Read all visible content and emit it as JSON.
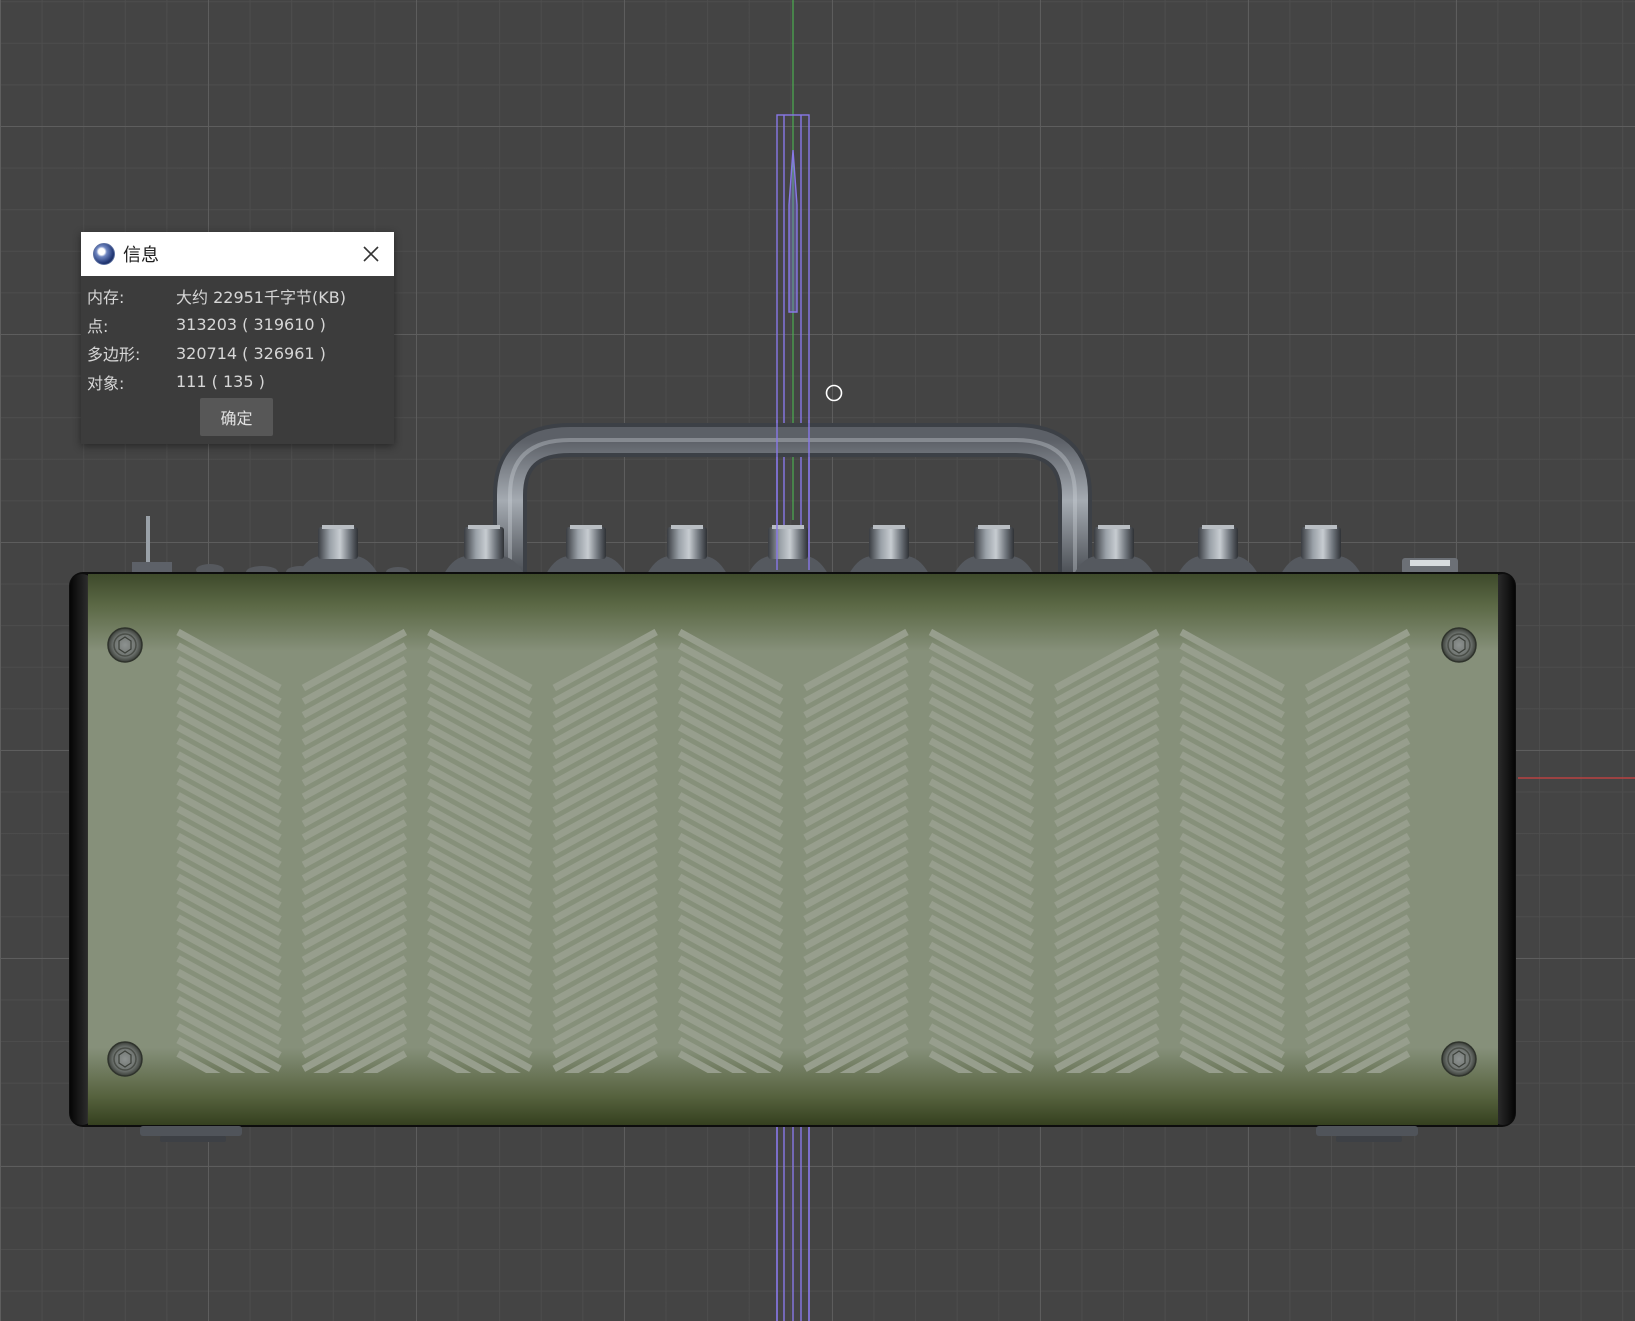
{
  "dialog": {
    "title": "信息",
    "rows": [
      {
        "label": "内存:",
        "value": "大约 22951千字节(KB)"
      },
      {
        "label": "点:",
        "value": "313203 ( 319610 )"
      },
      {
        "label": "多边形:",
        "value": "320714 ( 326961 )"
      },
      {
        "label": "对象:",
        "value": "111 ( 135 )"
      }
    ],
    "ok_label": "确定"
  },
  "colors": {
    "viewport_bg": "#444444",
    "amp_body": "#8a9079",
    "amp_frame": "#3f4a2d",
    "knob": "#808890",
    "y_axis": "#4caf50",
    "x_axis": "#d04040",
    "selection": "#8878e8"
  }
}
